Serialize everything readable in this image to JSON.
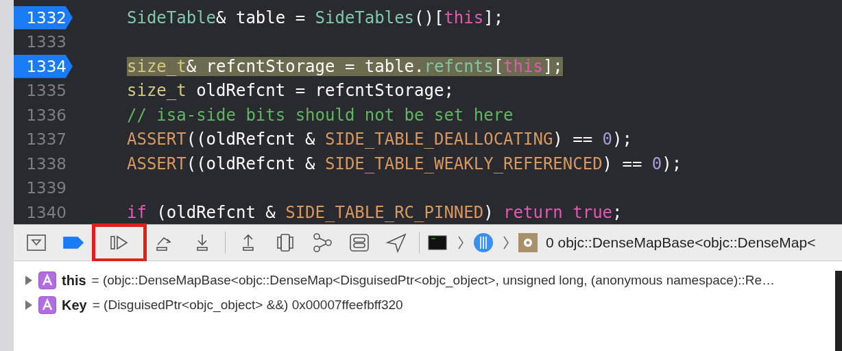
{
  "editor": {
    "lines": [
      {
        "number": "1332",
        "breakpoint": true,
        "highlighted": false,
        "tokens": [
          {
            "kind": "type",
            "text": "SideTable"
          },
          {
            "kind": "plain",
            "text": "& table = "
          },
          {
            "kind": "type",
            "text": "SideTables"
          },
          {
            "kind": "plain",
            "text": "()["
          },
          {
            "kind": "keyword",
            "text": "this"
          },
          {
            "kind": "plain",
            "text": "];"
          }
        ]
      },
      {
        "number": "1333",
        "breakpoint": false
      },
      {
        "number": "1334",
        "breakpoint": true,
        "highlighted": true,
        "tokens": [
          {
            "kind": "typedef",
            "text": "size_t"
          },
          {
            "kind": "plain",
            "text": "& refcntStorage = table."
          },
          {
            "kind": "type",
            "text": "refcnts"
          },
          {
            "kind": "plain",
            "text": "["
          },
          {
            "kind": "keyword",
            "text": "this"
          },
          {
            "kind": "plain",
            "text": "];"
          }
        ]
      },
      {
        "number": "1335",
        "breakpoint": false,
        "highlighted": false,
        "tokens": [
          {
            "kind": "typedef",
            "text": "size_t"
          },
          {
            "kind": "plain",
            "text": " oldRefcnt = refcntStorage;"
          }
        ]
      },
      {
        "number": "1336",
        "breakpoint": false,
        "highlighted": false,
        "tokens": [
          {
            "kind": "comment",
            "text": "// isa-side bits should not be set here"
          }
        ]
      },
      {
        "number": "1337",
        "breakpoint": false,
        "highlighted": false,
        "tokens": [
          {
            "kind": "macro",
            "text": "ASSERT"
          },
          {
            "kind": "plain",
            "text": "((oldRefcnt & "
          },
          {
            "kind": "macro",
            "text": "SIDE_TABLE_DEALLOCATING"
          },
          {
            "kind": "plain",
            "text": ") == "
          },
          {
            "kind": "number",
            "text": "0"
          },
          {
            "kind": "plain",
            "text": ");"
          }
        ]
      },
      {
        "number": "1338",
        "breakpoint": false,
        "highlighted": false,
        "tokens": [
          {
            "kind": "macro",
            "text": "ASSERT"
          },
          {
            "kind": "plain",
            "text": "((oldRefcnt & "
          },
          {
            "kind": "macro",
            "text": "SIDE_TABLE_WEAKLY_REFERENCED"
          },
          {
            "kind": "plain",
            "text": ") == "
          },
          {
            "kind": "number",
            "text": "0"
          },
          {
            "kind": "plain",
            "text": ");"
          }
        ]
      },
      {
        "number": "1339",
        "breakpoint": false
      },
      {
        "number": "1340",
        "breakpoint": false,
        "highlighted": false,
        "tokens": [
          {
            "kind": "keyword",
            "text": "if"
          },
          {
            "kind": "plain",
            "text": " (oldRefcnt & "
          },
          {
            "kind": "macro",
            "text": "SIDE_TABLE_RC_PINNED"
          },
          {
            "kind": "plain",
            "text": ") "
          },
          {
            "kind": "keyword",
            "text": "return true"
          },
          {
            "kind": "plain",
            "text": ";"
          }
        ]
      }
    ]
  },
  "debug_bar": {
    "buttons": [
      {
        "kind": "hide",
        "highlighted": false,
        "active": false
      },
      {
        "kind": "breakpoints",
        "highlighted": false,
        "active": true
      },
      {
        "kind": "continue",
        "highlighted": true,
        "active": false
      },
      {
        "kind": "step-over",
        "highlighted": false,
        "active": false
      },
      {
        "kind": "step-into",
        "highlighted": false,
        "active": false
      },
      {
        "kind": "step-out",
        "highlighted": false,
        "active": false
      },
      {
        "kind": "view-hierarchy",
        "highlighted": false,
        "active": false
      },
      {
        "kind": "memory-graph",
        "highlighted": false,
        "active": false
      },
      {
        "kind": "environment",
        "highlighted": false,
        "active": false
      },
      {
        "kind": "location",
        "highlighted": false,
        "active": false
      }
    ],
    "breadcrumb": {
      "frame": "0 objc::DenseMapBase<objc::DenseMap<"
    }
  },
  "variables": [
    {
      "name": "this",
      "value": "= (objc::DenseMapBase<objc::DenseMap<DisguisedPtr<objc_object>, unsigned long, (anonymous namespace)::Re…"
    },
    {
      "name": "Key",
      "value": "= (DisguisedPtr<objc_object> &&) 0x00007ffeefbff320"
    }
  ]
}
